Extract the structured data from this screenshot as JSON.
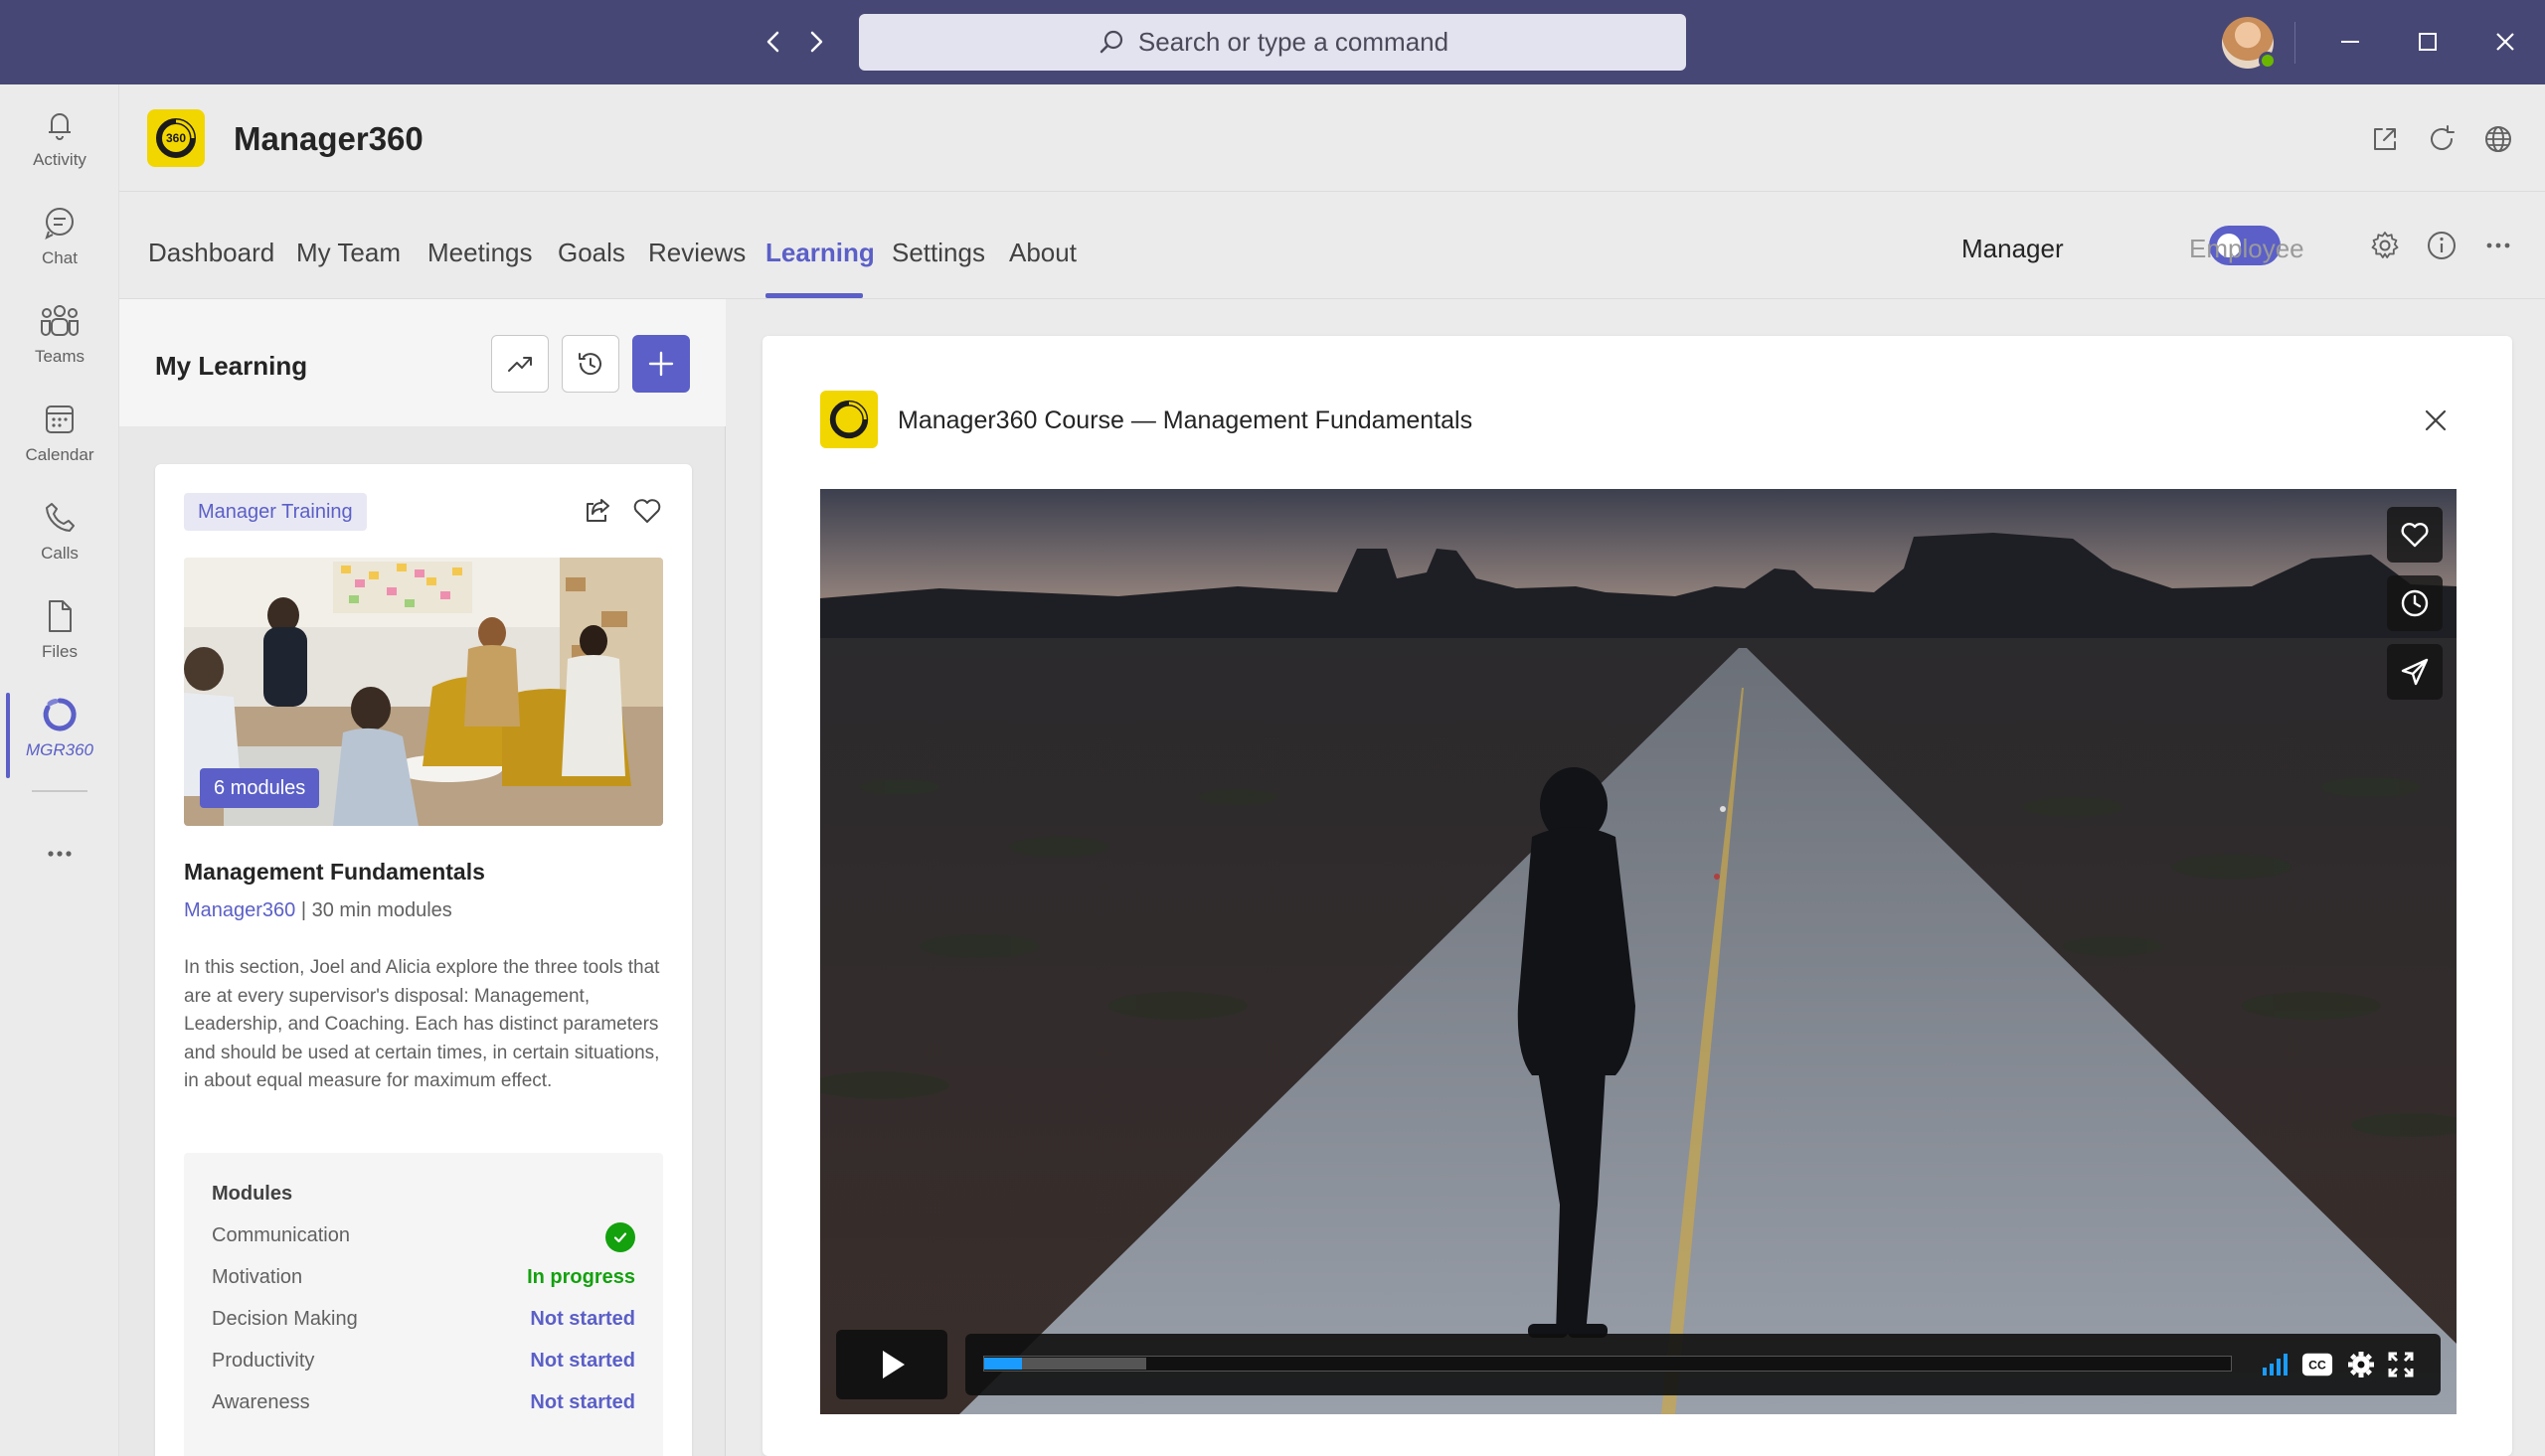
{
  "titlebar": {
    "search_placeholder": "Search or type a command"
  },
  "rail": {
    "items": [
      {
        "label": "Activity",
        "icon": "bell-icon"
      },
      {
        "label": "Chat",
        "icon": "chat-icon"
      },
      {
        "label": "Teams",
        "icon": "teams-icon"
      },
      {
        "label": "Calendar",
        "icon": "calendar-icon"
      },
      {
        "label": "Calls",
        "icon": "phone-icon"
      },
      {
        "label": "Files",
        "icon": "file-icon"
      },
      {
        "label": "MGR360",
        "icon": "mgr360-icon",
        "active": true
      }
    ]
  },
  "app": {
    "name": "Manager360",
    "logo_text": "360"
  },
  "nav": {
    "tabs": [
      "Dashboard",
      "My Team",
      "Meetings",
      "Goals",
      "Reviews",
      "Learning",
      "Settings",
      "About"
    ],
    "active_tab": "Learning",
    "role_left": "Manager",
    "role_right": "Employee",
    "toggle_on": true
  },
  "learning": {
    "title": "My Learning",
    "card": {
      "category": "Manager Training",
      "modules_count": "6 modules",
      "title": "Management Fundamentals",
      "source": "Manager360",
      "meta_sep": " | ",
      "duration": "30 min modules",
      "description": "In this section, Joel and Alicia explore the three tools that are at every supervisor's disposal: Management, Leadership, and Coaching. Each has distinct parameters and should be used at certain times, in certain situations, in about equal measure for maximum effect.",
      "modules_heading": "Modules",
      "modules": [
        {
          "name": "Communication",
          "status": "",
          "state": "complete"
        },
        {
          "name": "Motivation",
          "status": "In progress",
          "state": "in-progress"
        },
        {
          "name": "Decision Making",
          "status": "Not started",
          "state": "not-started"
        },
        {
          "name": "Productivity",
          "status": "Not started",
          "state": "not-started"
        },
        {
          "name": "Awareness",
          "status": "Not started",
          "state": "not-started"
        }
      ]
    }
  },
  "player": {
    "title": "Manager360 Course — Management Fundamentals",
    "progress_played": 0.03,
    "progress_buffered": 0.13
  },
  "colors": {
    "titlebar": "#464775",
    "accent": "#5b5fc7",
    "logo_yellow": "#f2d600",
    "in_progress": "#13a10e",
    "not_started": "#5b5fc7",
    "progress": "#1a9cff"
  }
}
